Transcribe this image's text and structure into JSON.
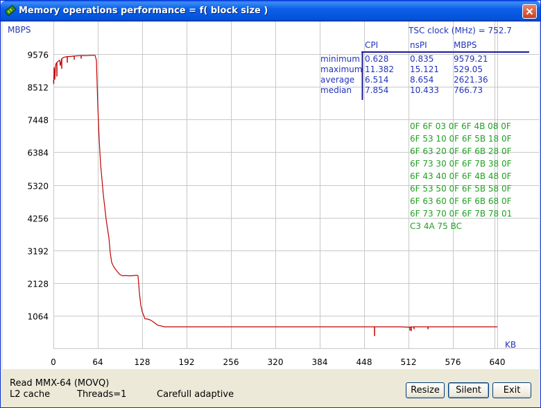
{
  "window": {
    "title": "Memory operations performance = f( block size )"
  },
  "chart_data": {
    "type": "line",
    "ylabel": "MBPS",
    "xlabel": "KB",
    "x_ticks": [
      0,
      64,
      128,
      192,
      256,
      320,
      384,
      448,
      512,
      576,
      640
    ],
    "y_ticks": [
      1064,
      2128,
      3192,
      4256,
      5320,
      6384,
      7448,
      8512,
      9576
    ],
    "xlim": [
      0,
      700
    ],
    "ylim": [
      0,
      10640
    ],
    "grid": true,
    "line_color": "#c00000",
    "series": [
      {
        "x": [
          0,
          0.5,
          1,
          1.5,
          2,
          3,
          4,
          5,
          6,
          7,
          8,
          9,
          10,
          12,
          14,
          16,
          20,
          24,
          28,
          32,
          40,
          48,
          56,
          58,
          60,
          62,
          64,
          66,
          68,
          70,
          72,
          74,
          76,
          78,
          80,
          82,
          84,
          86,
          88,
          90,
          92,
          96,
          100,
          104,
          108,
          112,
          116,
          120,
          122,
          124,
          126,
          128,
          132,
          136,
          140,
          144,
          150,
          160,
          200,
          250,
          300,
          350,
          400,
          440,
          448,
          450,
          460,
          470,
          490,
          500,
          512,
          520,
          540,
          560,
          600,
          640
        ],
        "y": [
          8730,
          8600,
          9150,
          9050,
          8750,
          9200,
          9280,
          9300,
          9330,
          9350,
          9360,
          9380,
          9200,
          9430,
          9460,
          9480,
          9500,
          9500,
          9510,
          9520,
          9530,
          9530,
          9540,
          9540,
          9540,
          9380,
          7900,
          6800,
          6000,
          5500,
          5000,
          4600,
          4200,
          3900,
          3600,
          3100,
          2800,
          2700,
          2620,
          2560,
          2500,
          2400,
          2360,
          2370,
          2360,
          2360,
          2370,
          2380,
          2360,
          1800,
          1400,
          1200,
          960,
          950,
          920,
          860,
          760,
          700,
          700,
          700,
          700,
          700,
          700,
          700,
          700,
          700,
          700,
          700,
          700,
          700,
          690,
          700,
          700,
          700,
          700,
          700
        ]
      }
    ],
    "spikes": [
      {
        "x": 5,
        "from": 9300,
        "to": 8850
      },
      {
        "x": 12,
        "from": 9430,
        "to": 9100
      },
      {
        "x": 20,
        "from": 9500,
        "to": 9300
      },
      {
        "x": 30,
        "from": 9520,
        "to": 9400
      },
      {
        "x": 40,
        "from": 9530,
        "to": 9430
      },
      {
        "x": 463,
        "from": 700,
        "to": 400
      },
      {
        "x": 514,
        "from": 700,
        "to": 580
      },
      {
        "x": 516,
        "from": 700,
        "to": 560
      },
      {
        "x": 520,
        "from": 700,
        "to": 620
      },
      {
        "x": 540,
        "from": 700,
        "to": 620
      }
    ]
  },
  "stats": {
    "tsc_label": "TSC clock (MHz)  =  752.7",
    "headers": [
      "CPI",
      "nsPI",
      "MBPS"
    ],
    "rows": [
      {
        "label": "minimum",
        "values": [
          "0.628",
          "0.835",
          "9579.21"
        ]
      },
      {
        "label": "maximum",
        "values": [
          "11.382",
          "15.121",
          "529.05"
        ]
      },
      {
        "label": "average",
        "values": [
          "6.514",
          "8.654",
          "2621.36"
        ]
      },
      {
        "label": "median",
        "values": [
          "7.854",
          "10.433",
          "766.73"
        ]
      }
    ]
  },
  "hex_dump": [
    "0F  6F  03   0F  6F  4B  08  0F",
    "6F  53  10   0F  6F  5B  18  0F",
    "6F  63  20   0F  6F  6B  28  0F",
    "6F  73  30   0F  6F  7B  38  0F",
    "6F  43  40   0F  6F  4B  48  0F",
    "6F  53  50   0F  6F  5B  58  0F",
    "6F  63  60   0F  6F  6B  68  0F",
    "6F  73  70   0F  6F  7B  78  01",
    "C3  4A  75   BC"
  ],
  "status": {
    "method": "Read MMX-64 (MOVQ)",
    "cache": "L2 cache",
    "threads": "Threads=1",
    "mode": "Carefull adaptive"
  },
  "buttons": {
    "resize": "Resize",
    "silent": "Silent",
    "exit": "Exit"
  },
  "colors": {
    "axis_text": "#2233bb",
    "stats_text": "#2233bb",
    "hex_text": "#22a022",
    "grid": "#c8c8c8"
  }
}
